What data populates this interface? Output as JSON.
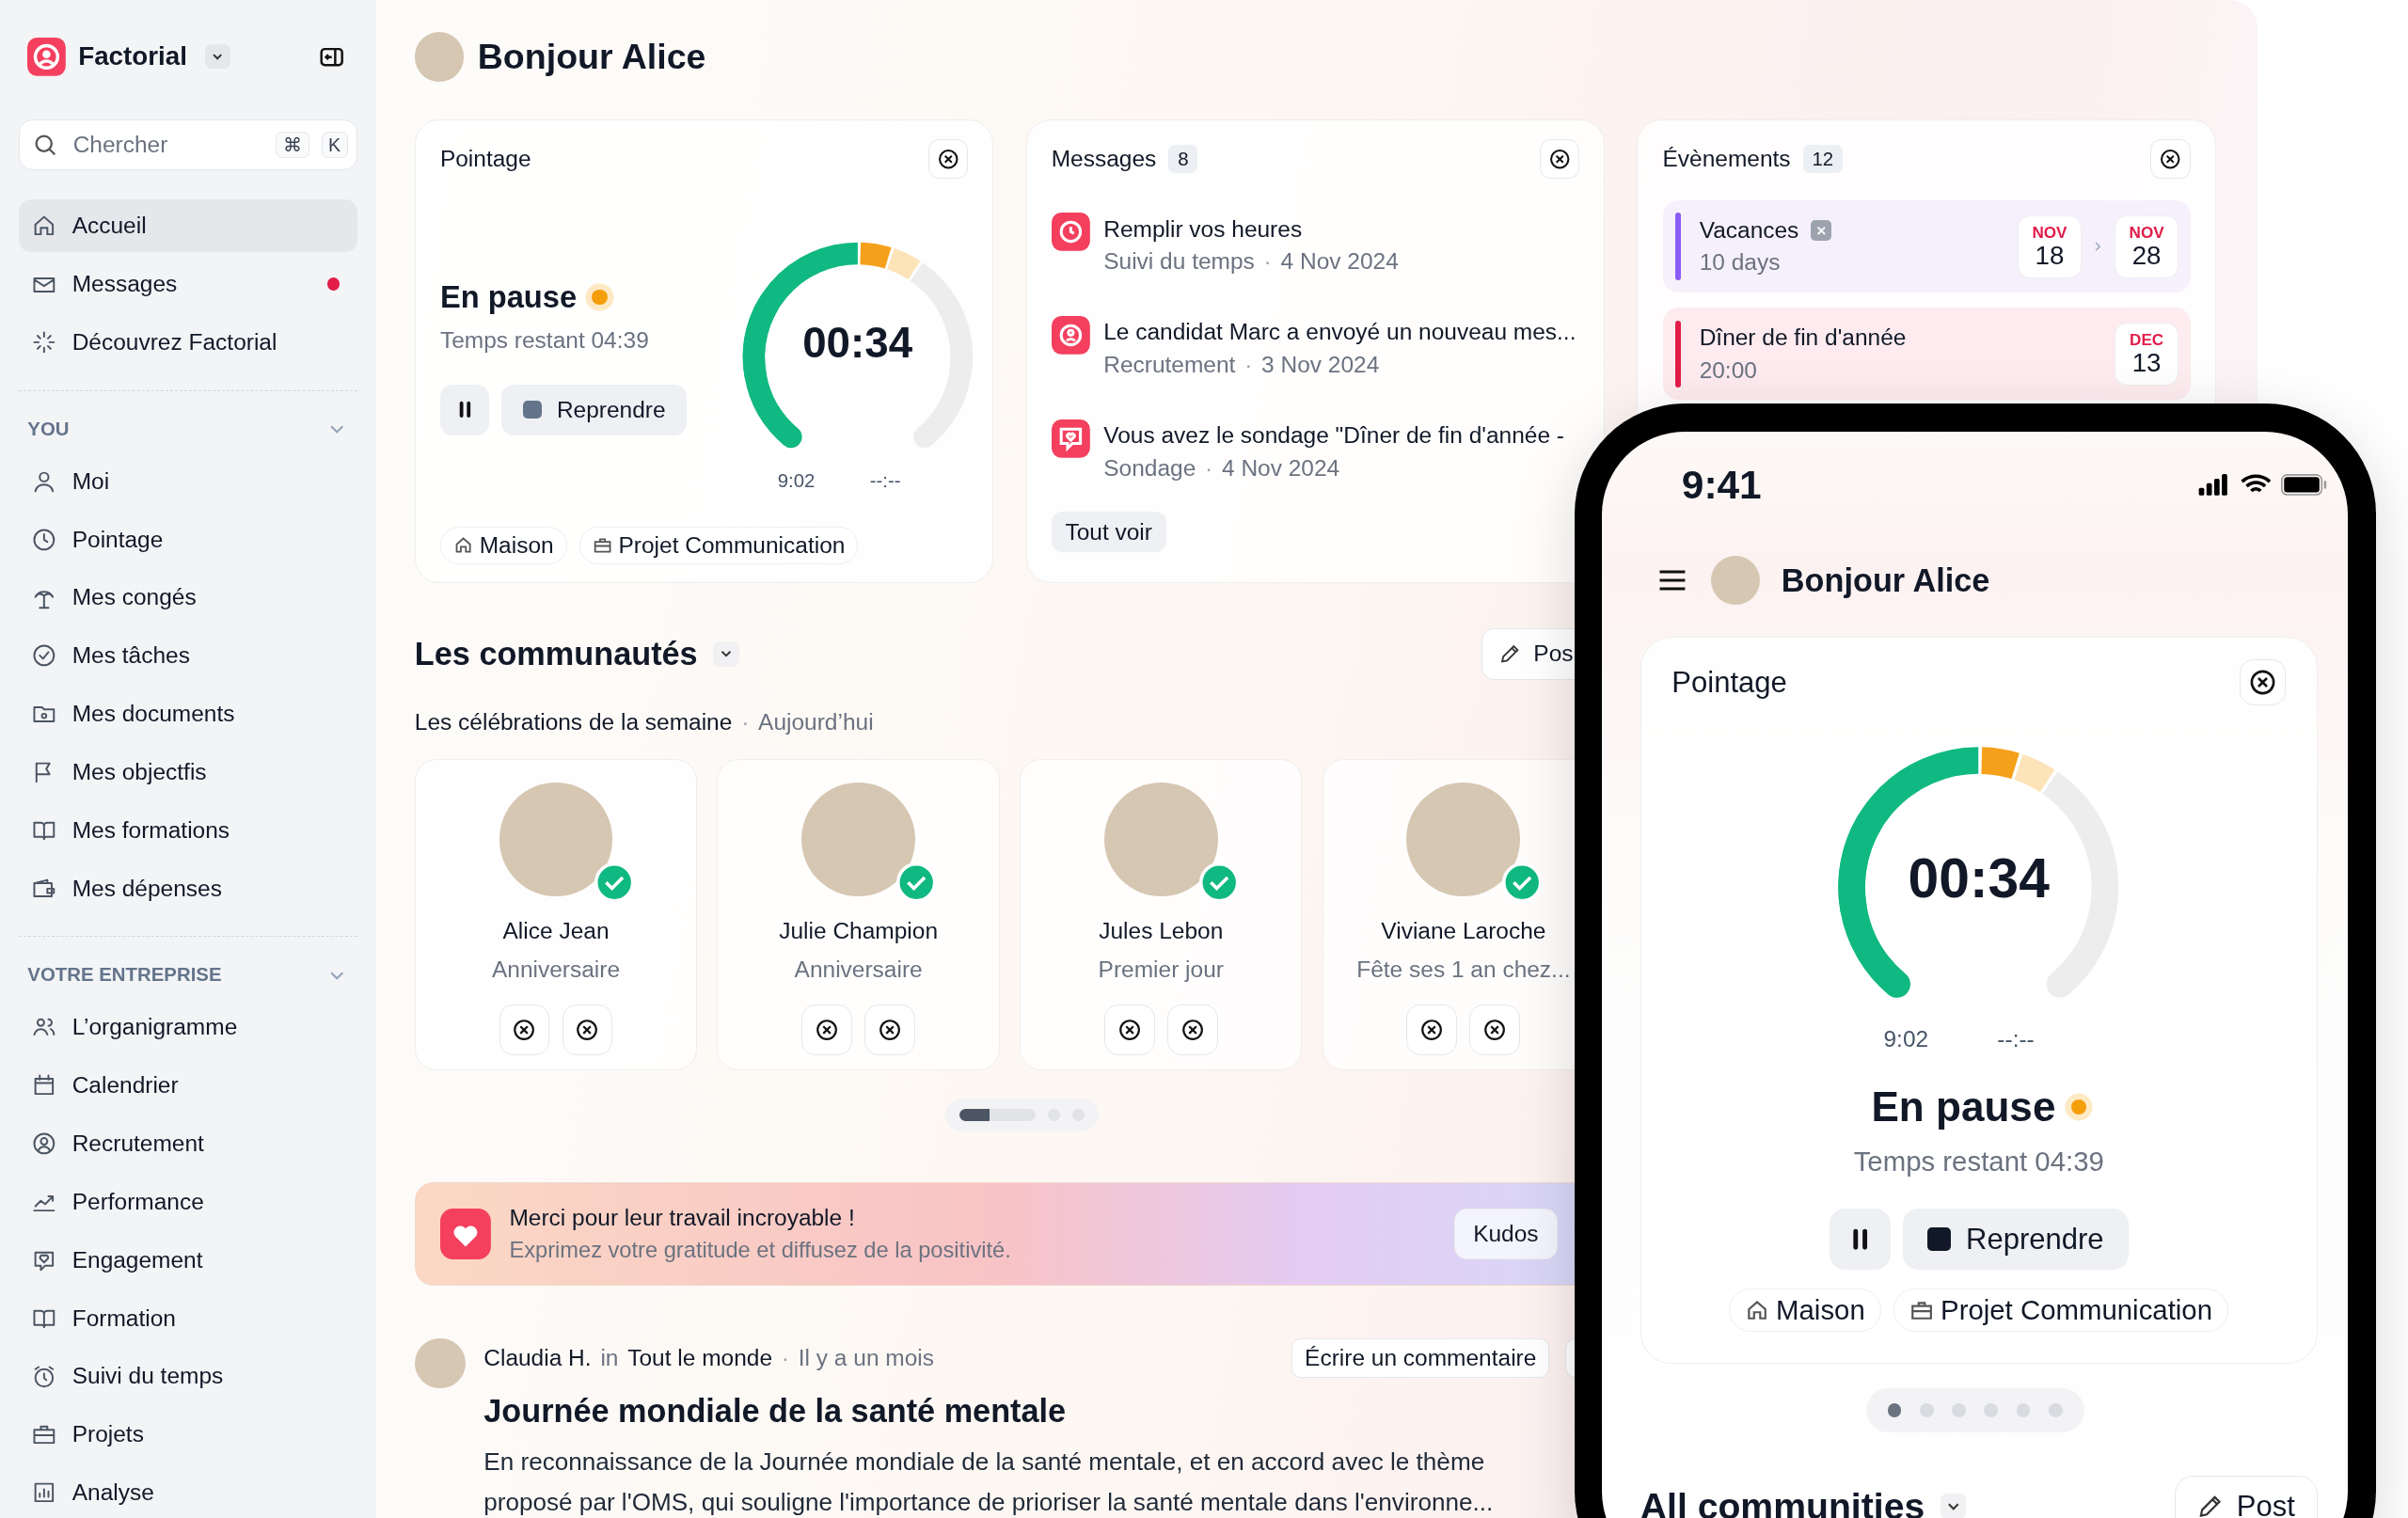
{
  "sidebar": {
    "brand": "Factorial",
    "search": {
      "placeholder": "Chercher",
      "shortcut": [
        "⌘",
        "K"
      ]
    },
    "items": [
      {
        "label": "Accueil",
        "selected": true,
        "unread": false
      },
      {
        "label": "Messages",
        "selected": false,
        "unread": true
      },
      {
        "label": "Découvrez Factorial",
        "selected": false,
        "unread": false
      }
    ],
    "sections": [
      {
        "title": "YOU",
        "expanded": true,
        "items": [
          {
            "label": "Moi",
            "selected": false
          },
          {
            "label": "Pointage",
            "selected": false
          },
          {
            "label": "Mes congés",
            "selected": false
          },
          {
            "label": "Mes tâches",
            "selected": false
          },
          {
            "label": "Mes documents",
            "selected": false
          },
          {
            "label": "Mes objectfis",
            "selected": false
          },
          {
            "label": "Mes formations",
            "selected": false
          },
          {
            "label": "Mes dépenses",
            "selected": false
          }
        ]
      },
      {
        "title": "VOTRE ENTREPRISE",
        "expanded": true,
        "items": [
          {
            "label": "L’organigramme",
            "selected": false
          },
          {
            "label": "Calendrier",
            "selected": false
          },
          {
            "label": "Recrutement",
            "selected": false
          },
          {
            "label": "Performance",
            "selected": false
          },
          {
            "label": "Engagement",
            "selected": false
          },
          {
            "label": "Formation",
            "selected": false
          },
          {
            "label": "Suivi du temps",
            "selected": false
          },
          {
            "label": "Projets",
            "selected": false
          },
          {
            "label": "Analyse",
            "selected": false
          }
        ]
      }
    ]
  },
  "greeting": "Bonjour Alice",
  "pointage": {
    "title": "Pointage",
    "status": "En pause",
    "remaining": "Temps restant 04:39",
    "time": "00:34",
    "start": "9:02",
    "end": "--:--",
    "resume": "Reprendre",
    "tags": [
      "Maison",
      "Projet Communication"
    ]
  },
  "messages": {
    "title": "Messages",
    "count": "8",
    "more": "Tout voir",
    "items": [
      {
        "kind": "clock",
        "title": "Remplir vos heures",
        "source": "Suivi du temps",
        "separator": "·",
        "date": "4 Nov 2024"
      },
      {
        "kind": "person",
        "title": "Le candidat Marc a envoyé un nouveau mes...",
        "source": "Recrutement",
        "separator": "·",
        "date": "3 Nov 2024"
      },
      {
        "kind": "survey",
        "title": "Vous avez le sondage \"Dîner de fin d'année -",
        "source": "Sondage",
        "separator": "·",
        "date": "4 Nov 2024"
      }
    ]
  },
  "events": {
    "title": "Évènements",
    "count": "12",
    "items": [
      {
        "title": "Vacances",
        "subtitle": "10 days",
        "color": "#8b5cf6",
        "removable": true,
        "dates": [
          {
            "month": "NOV",
            "day": "18"
          },
          {
            "month": "NOV",
            "day": "28"
          }
        ]
      },
      {
        "title": "Dîner de fin d'année",
        "subtitle": "20:00",
        "color": "#e11d48",
        "removable": false,
        "dates": [
          {
            "month": "DEC",
            "day": "13"
          }
        ]
      }
    ]
  },
  "communities": {
    "title": "Les communautés",
    "post_button": "Pos",
    "celebrations_title": "Les célébrations de la semaine",
    "separator": "·",
    "when": "Aujourd’hui",
    "people": [
      {
        "name": "Alice Jean",
        "reason": "Anniversaire"
      },
      {
        "name": "Julie Champion",
        "reason": "Anniversaire"
      },
      {
        "name": "Jules Lebon",
        "reason": "Premier jour"
      },
      {
        "name": "Viviane Laroche",
        "reason": "Fête ses 1 an chez..."
      }
    ],
    "pages": [
      {
        "selected": true
      },
      {
        "selected": false
      },
      {
        "selected": false
      }
    ]
  },
  "kudos": {
    "title": "Merci pour leur travail incroyable !",
    "text": "Exprimez votre gratitude et diffusez de la positivité.",
    "button": "Kudos"
  },
  "post": {
    "author": "Claudia H.",
    "in": "in",
    "audience": "Tout le monde",
    "separator": "·",
    "time": "Il y a un mois",
    "comment_button": "Écrire un commentaire",
    "title": "Journée mondiale de la santé mentale",
    "body": "En reconnaissance de la Journée mondiale de la santé mentale, et en accord avec le thème proposé par l'OMS, qui souligne l'importance de prioriser la santé mentale dans l'environne..."
  },
  "phone": {
    "time": "9:41",
    "greeting": "Bonjour Alice",
    "pointage": {
      "title": "Pointage",
      "status": "En pause",
      "remaining": "Temps restant 04:39",
      "time": "00:34",
      "start": "9:02",
      "end": "--:--",
      "resume": "Reprendre",
      "tags": [
        "Maison",
        "Projet Communication"
      ]
    },
    "pages": [
      {
        "selected": true
      },
      {
        "selected": false
      },
      {
        "selected": false
      },
      {
        "selected": false
      },
      {
        "selected": false
      },
      {
        "selected": false
      }
    ],
    "communities_title": "All communities",
    "post_button": "Post"
  }
}
